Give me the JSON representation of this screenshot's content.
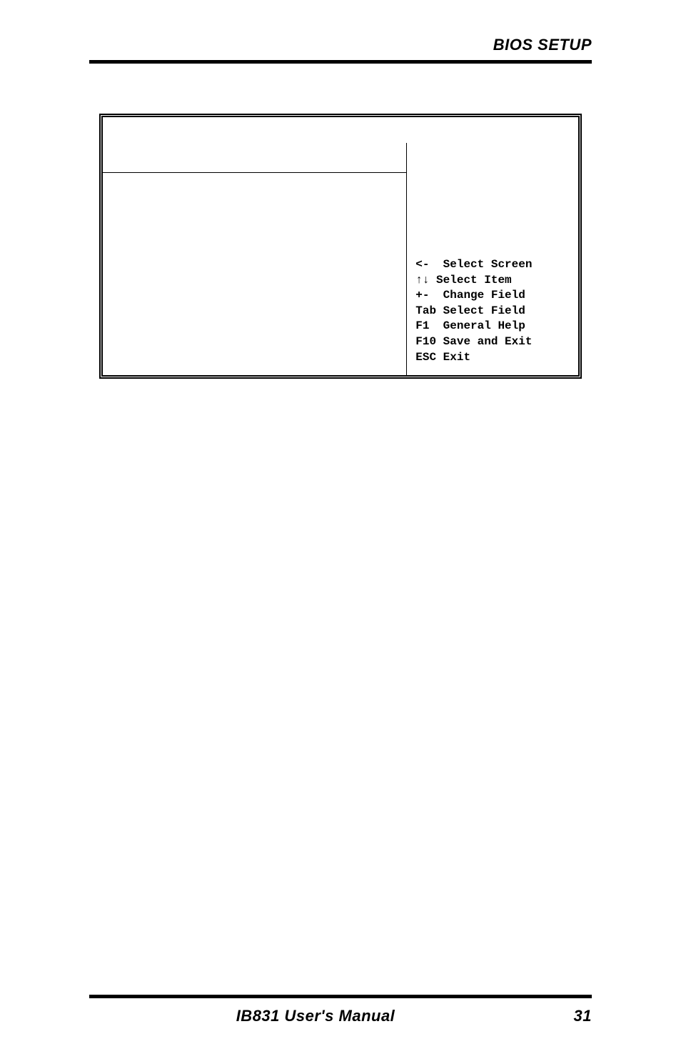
{
  "header": {
    "title": "BIOS SETUP"
  },
  "bios": {
    "help": {
      "l1": "<-  Select Screen",
      "l2": "↑↓ Select Item",
      "l3": "+-  Change Field",
      "l4": "Tab Select Field",
      "l5": "F1  General Help",
      "l6": "F10 Save and Exit",
      "l7": "ESC Exit"
    }
  },
  "footer": {
    "manual": "IB831 User's Manual",
    "page": "31"
  }
}
